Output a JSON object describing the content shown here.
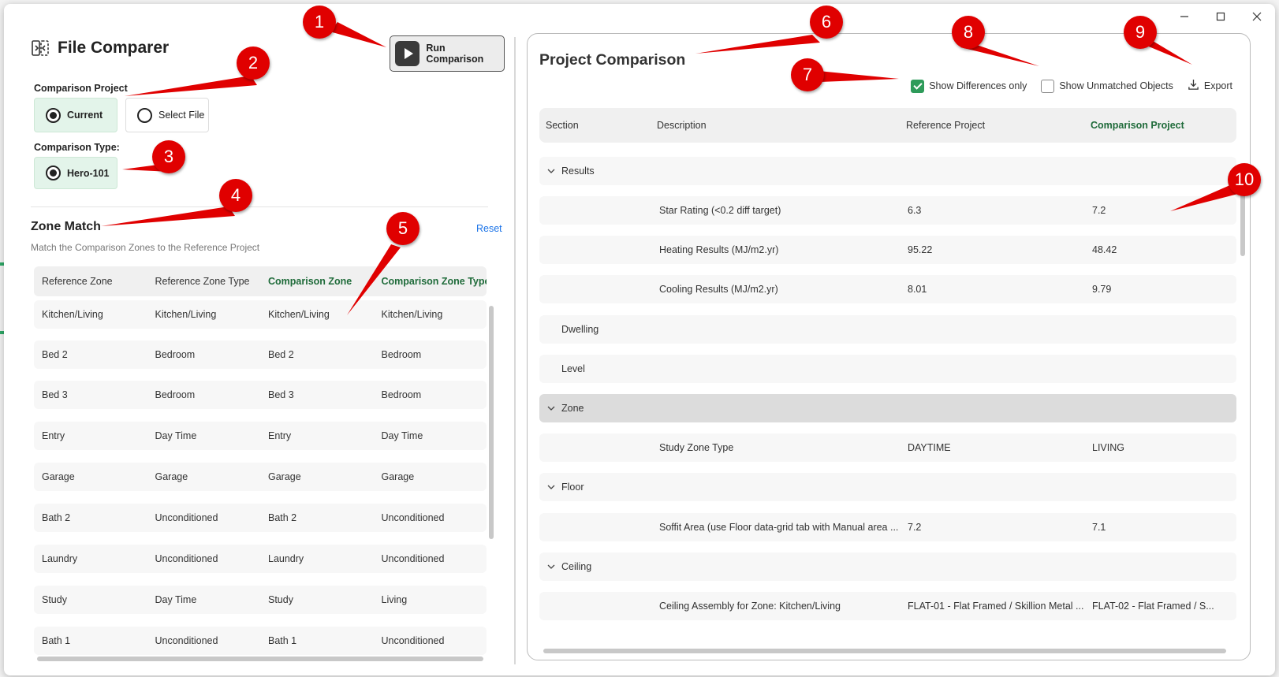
{
  "window": {
    "title_controls": [
      "minimize",
      "maximize",
      "close"
    ]
  },
  "app": {
    "title": "File Comparer",
    "run_button_label": "Run Comparison"
  },
  "comparison_project": {
    "label": "Comparison Project",
    "options": [
      {
        "label": "Current",
        "selected": true
      },
      {
        "label": "Select File",
        "selected": false
      }
    ]
  },
  "comparison_type": {
    "label": "Comparison Type:",
    "options": [
      {
        "label": "Hero-101",
        "selected": true
      }
    ]
  },
  "zone_match": {
    "title": "Zone Match",
    "reset_label": "Reset",
    "subtitle": "Match the Comparison Zones to the Reference Project",
    "columns": [
      "Reference Zone",
      "Reference Zone Type",
      "Comparison Zone",
      "Comparison Zone Type"
    ],
    "rows": [
      [
        "Kitchen/Living",
        "Kitchen/Living",
        "Kitchen/Living",
        "Kitchen/Living"
      ],
      [
        "Bed 2",
        "Bedroom",
        "Bed 2",
        "Bedroom"
      ],
      [
        "Bed 3",
        "Bedroom",
        "Bed 3",
        "Bedroom"
      ],
      [
        "Entry",
        "Day Time",
        "Entry",
        "Day Time"
      ],
      [
        "Garage",
        "Garage",
        "Garage",
        "Garage"
      ],
      [
        "Bath 2",
        "Unconditioned",
        "Bath 2",
        "Unconditioned"
      ],
      [
        "Laundry",
        "Unconditioned",
        "Laundry",
        "Unconditioned"
      ],
      [
        "Study",
        "Day Time",
        "Study",
        "Living"
      ],
      [
        "Bath 1",
        "Unconditioned",
        "Bath 1",
        "Unconditioned"
      ]
    ]
  },
  "project_comparison": {
    "title": "Project Comparison",
    "options": [
      {
        "label": "Show Differences only",
        "checked": true
      },
      {
        "label": "Show Unmatched Objects",
        "checked": false
      }
    ],
    "export_label": "Export",
    "columns": [
      "Section",
      "Description",
      "Reference Project",
      "Comparison Project"
    ],
    "rows": [
      {
        "kind": "section",
        "section": "Results",
        "expanded": true
      },
      {
        "kind": "item",
        "description": "Star Rating (<0.2 diff target)",
        "reference": "6.3",
        "comparison": "7.2"
      },
      {
        "kind": "item",
        "description": "Heating Results (MJ/m2.yr)",
        "reference": "95.22",
        "comparison": "48.42"
      },
      {
        "kind": "item",
        "description": "Cooling Results (MJ/m2.yr)",
        "reference": "8.01",
        "comparison": "9.79"
      },
      {
        "kind": "plain",
        "section": "Dwelling"
      },
      {
        "kind": "plain",
        "section": "Level"
      },
      {
        "kind": "section",
        "section": "Zone",
        "expanded": true,
        "selected": true
      },
      {
        "kind": "item",
        "description": "Study Zone Type",
        "reference": "DAYTIME",
        "comparison": "LIVING"
      },
      {
        "kind": "section",
        "section": "Floor",
        "expanded": true
      },
      {
        "kind": "item",
        "description": "Soffit Area (use Floor data-grid tab with Manual area ...",
        "reference": "7.2",
        "comparison": "7.1"
      },
      {
        "kind": "section",
        "section": "Ceiling",
        "expanded": true
      },
      {
        "kind": "item",
        "description": "Ceiling Assembly for Zone: Kitchen/Living",
        "reference": "FLAT-01 - Flat Framed / Skillion Metal ...",
        "comparison": "FLAT-02 - Flat Framed / S..."
      }
    ]
  },
  "callouts": [
    "1",
    "2",
    "3",
    "4",
    "5",
    "6",
    "7",
    "8",
    "9",
    "10"
  ],
  "colors": {
    "accent_green": "#1f6b3a",
    "selected_card": "#e3f4ea",
    "callout_red": "#e00000",
    "link_blue": "#1a73e8"
  }
}
